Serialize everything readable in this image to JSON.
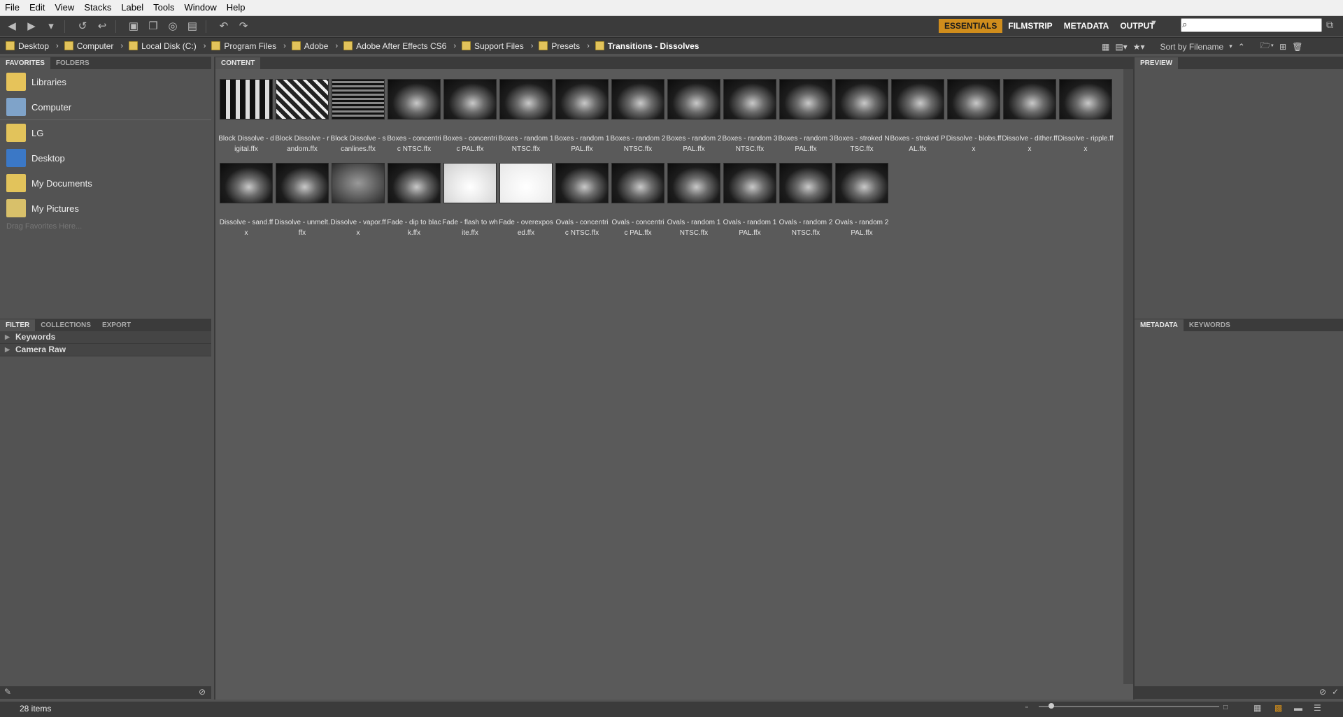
{
  "menu": [
    "File",
    "Edit",
    "View",
    "Stacks",
    "Label",
    "Tools",
    "Window",
    "Help"
  ],
  "workspaces": [
    "ESSENTIALS",
    "FILMSTRIP",
    "METADATA",
    "OUTPUT"
  ],
  "breadcrumb": [
    "Desktop",
    "Computer",
    "Local Disk (C:)",
    "Program Files",
    "Adobe",
    "Adobe After Effects CS6",
    "Support Files",
    "Presets",
    "Transitions - Dissolves"
  ],
  "sort_label": "Sort by Filename",
  "left_tabs": [
    "FAVORITES",
    "FOLDERS"
  ],
  "favorites": [
    {
      "label": "Libraries",
      "icon": "libraries-icon"
    },
    {
      "label": "Computer",
      "icon": "computer-icon"
    },
    {
      "label": "LG",
      "icon": "folder-icon"
    },
    {
      "label": "Desktop",
      "icon": "desktop-icon"
    },
    {
      "label": "My Documents",
      "icon": "documents-icon"
    },
    {
      "label": "My Pictures",
      "icon": "pictures-icon"
    }
  ],
  "favorites_hint": "Drag Favorites Here...",
  "filter_tabs": [
    "FILTER",
    "COLLECTIONS",
    "EXPORT"
  ],
  "filter_rows": [
    "Keywords",
    "Camera Raw"
  ],
  "content_tab": "CONTENT",
  "preview_tab": "PREVIEW",
  "metadata_tabs": [
    "METADATA",
    "KEYWORDS"
  ],
  "items": [
    "Block Dissolve - digital.ffx",
    "Block Dissolve - random.ffx",
    "Block Dissolve - scanlines.ffx",
    "Boxes - concentric NTSC.ffx",
    "Boxes - concentric PAL.ffx",
    "Boxes - random 1 NTSC.ffx",
    "Boxes - random 1 PAL.ffx",
    "Boxes - random 2 NTSC.ffx",
    "Boxes - random 2 PAL.ffx",
    "Boxes - random 3 NTSC.ffx",
    "Boxes - random 3 PAL.ffx",
    "Boxes - stroked NTSC.ffx",
    "Boxes - stroked PAL.ffx",
    "Dissolve - blobs.ffx",
    "Dissolve - dither.ffx",
    "Dissolve - ripple.ffx",
    "Dissolve - sand.ffx",
    "Dissolve - unmelt.ffx",
    "Dissolve - vapor.ffx",
    "Fade - dip to black.ffx",
    "Fade - flash to white.ffx",
    "Fade - overexposed.ffx",
    "Ovals - concentric NTSC.ffx",
    "Ovals - concentric PAL.ffx",
    "Ovals - random 1 NTSC.ffx",
    "Ovals - random 1 PAL.ffx",
    "Ovals - random 2 NTSC.ffx",
    "Ovals - random 2 PAL.ffx"
  ],
  "status": "28 items"
}
